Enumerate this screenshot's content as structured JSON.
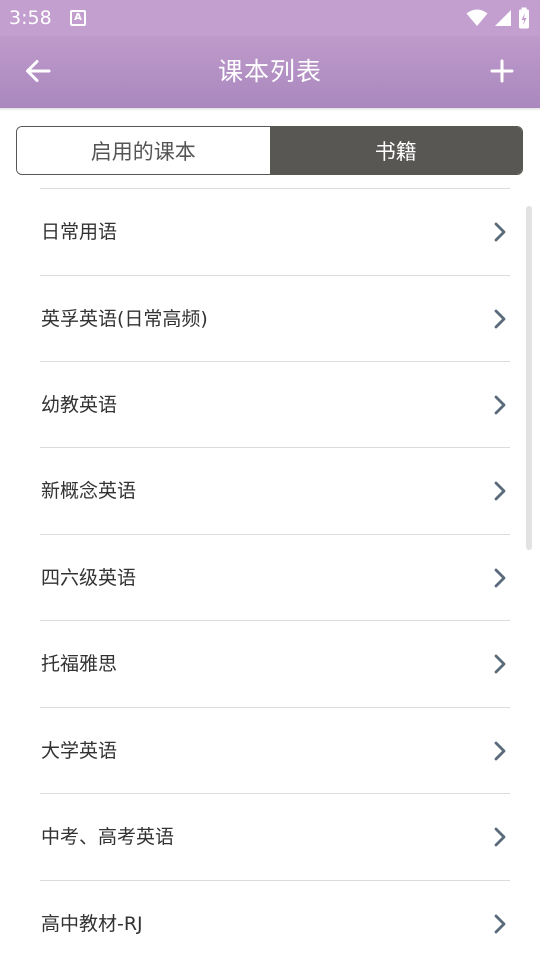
{
  "status_bar": {
    "time": "3:58",
    "notification_icon_letter": "A",
    "icons": [
      "wifi-icon",
      "cellular-signal-icon",
      "battery-charging-icon"
    ]
  },
  "header": {
    "title": "课本列表",
    "back_icon": "arrow-left-icon",
    "add_icon": "plus-icon",
    "background_color": "#b592c6"
  },
  "tabs": [
    {
      "label": "启用的课本",
      "selected": false
    },
    {
      "label": "书籍",
      "selected": true
    }
  ],
  "list": {
    "items": [
      {
        "label": "日常用语"
      },
      {
        "label": "英孚英语(日常高频)"
      },
      {
        "label": "幼教英语"
      },
      {
        "label": "新概念英语"
      },
      {
        "label": "四六级英语"
      },
      {
        "label": "托福雅思"
      },
      {
        "label": "大学英语"
      },
      {
        "label": "中考、高考英语"
      },
      {
        "label": "高中教材-RJ"
      }
    ],
    "chevron_icon": "chevron-right-icon"
  },
  "colors": {
    "accent": "#b592c6",
    "tab_selected": "#595754",
    "chevron": "#5a6a7a"
  }
}
